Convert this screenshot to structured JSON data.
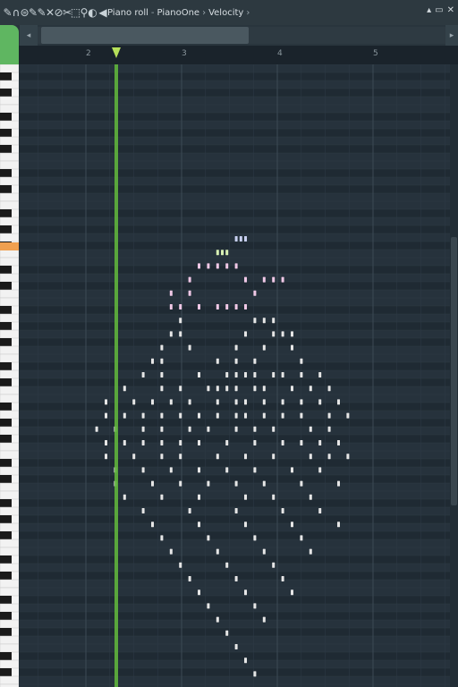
{
  "titlebar": {
    "tools": [
      {
        "name": "pencil-tool-icon",
        "glyph": "✎"
      },
      {
        "name": "magnet-icon",
        "glyph": "∩"
      },
      {
        "name": "stamp-icon",
        "glyph": "⊜"
      },
      {
        "name": "draw-tool-icon",
        "glyph": "✎"
      },
      {
        "name": "paint-tool-icon",
        "glyph": "✎"
      },
      {
        "name": "delete-tool-icon",
        "glyph": "✕"
      },
      {
        "name": "mute-tool-icon",
        "glyph": "⊘"
      },
      {
        "name": "slice-tool-icon",
        "glyph": "✂"
      },
      {
        "name": "select-tool-icon",
        "glyph": "⬚"
      },
      {
        "name": "zoom-tool-icon",
        "glyph": "⚲"
      },
      {
        "name": "playback-tool-icon",
        "glyph": "◐"
      }
    ],
    "speaker_glyph": "◀",
    "breadcrumb": [
      "Piano roll",
      "PianoOne",
      "Velocity"
    ],
    "sep1": "-",
    "sep2": "›",
    "sep3": "›",
    "win_buttons": [
      "▴",
      "▭",
      "✕"
    ]
  },
  "scrollbar": {
    "left_arrow": "◂",
    "right_arrow": "▸"
  },
  "ruler": {
    "bars": [
      "2",
      "3",
      "4",
      "5"
    ]
  },
  "piano_roll": {
    "playhead_color": "#5fb23c",
    "note_colors": [
      "#c8d0f0",
      "#d8f0b4",
      "#f0c8e6",
      "#e6e6e6"
    ],
    "notes": [
      [
        16,
        80,
        0
      ],
      [
        18,
        80,
        0
      ],
      [
        20,
        80,
        0
      ],
      [
        8,
        88,
        1
      ],
      [
        10,
        88,
        1
      ],
      [
        12,
        88,
        1
      ],
      [
        0,
        96,
        2
      ],
      [
        4,
        96,
        2
      ],
      [
        8,
        96,
        2
      ],
      [
        12,
        96,
        2
      ],
      [
        16,
        96,
        2
      ],
      [
        -4,
        104,
        2
      ],
      [
        20,
        104,
        2
      ],
      [
        28,
        104,
        2
      ],
      [
        32,
        104,
        2
      ],
      [
        36,
        104,
        2
      ],
      [
        -12,
        112,
        2
      ],
      [
        -4,
        112,
        2
      ],
      [
        24,
        112,
        2
      ],
      [
        -12,
        120,
        2
      ],
      [
        -8,
        120,
        2
      ],
      [
        0,
        120,
        2
      ],
      [
        8,
        120,
        2
      ],
      [
        12,
        120,
        2
      ],
      [
        16,
        120,
        2
      ],
      [
        20,
        120,
        2
      ],
      [
        -8,
        128,
        3
      ],
      [
        24,
        128,
        3
      ],
      [
        28,
        128,
        3
      ],
      [
        32,
        128,
        3
      ],
      [
        -12,
        136,
        3
      ],
      [
        -8,
        136,
        3
      ],
      [
        20,
        136,
        3
      ],
      [
        32,
        136,
        3
      ],
      [
        36,
        136,
        3
      ],
      [
        40,
        136,
        3
      ],
      [
        -16,
        144,
        3
      ],
      [
        -4,
        144,
        3
      ],
      [
        16,
        144,
        3
      ],
      [
        28,
        144,
        3
      ],
      [
        40,
        144,
        3
      ],
      [
        -20,
        152,
        3
      ],
      [
        -16,
        152,
        3
      ],
      [
        8,
        152,
        3
      ],
      [
        16,
        152,
        3
      ],
      [
        24,
        152,
        3
      ],
      [
        44,
        152,
        3
      ],
      [
        -24,
        160,
        3
      ],
      [
        -16,
        160,
        3
      ],
      [
        0,
        160,
        3
      ],
      [
        12,
        160,
        3
      ],
      [
        16,
        160,
        3
      ],
      [
        20,
        160,
        3
      ],
      [
        24,
        160,
        3
      ],
      [
        32,
        160,
        3
      ],
      [
        36,
        160,
        3
      ],
      [
        44,
        160,
        3
      ],
      [
        52,
        160,
        3
      ],
      [
        -32,
        168,
        3
      ],
      [
        -16,
        168,
        3
      ],
      [
        -8,
        168,
        3
      ],
      [
        4,
        168,
        3
      ],
      [
        8,
        168,
        3
      ],
      [
        12,
        168,
        3
      ],
      [
        16,
        168,
        3
      ],
      [
        24,
        168,
        3
      ],
      [
        28,
        168,
        3
      ],
      [
        40,
        168,
        3
      ],
      [
        48,
        168,
        3
      ],
      [
        56,
        168,
        3
      ],
      [
        -40,
        176,
        3
      ],
      [
        -28,
        176,
        3
      ],
      [
        -20,
        176,
        3
      ],
      [
        -12,
        176,
        3
      ],
      [
        -4,
        176,
        3
      ],
      [
        8,
        176,
        3
      ],
      [
        16,
        176,
        3
      ],
      [
        20,
        176,
        3
      ],
      [
        28,
        176,
        3
      ],
      [
        36,
        176,
        3
      ],
      [
        44,
        176,
        3
      ],
      [
        52,
        176,
        3
      ],
      [
        60,
        176,
        3
      ],
      [
        -40,
        184,
        3
      ],
      [
        -32,
        184,
        3
      ],
      [
        -24,
        184,
        3
      ],
      [
        -16,
        184,
        3
      ],
      [
        -8,
        184,
        3
      ],
      [
        0,
        184,
        3
      ],
      [
        8,
        184,
        3
      ],
      [
        16,
        184,
        3
      ],
      [
        20,
        184,
        3
      ],
      [
        28,
        184,
        3
      ],
      [
        36,
        184,
        3
      ],
      [
        44,
        184,
        3
      ],
      [
        56,
        184,
        3
      ],
      [
        64,
        184,
        3
      ],
      [
        -44,
        192,
        3
      ],
      [
        -36,
        192,
        3
      ],
      [
        -24,
        192,
        3
      ],
      [
        -16,
        192,
        3
      ],
      [
        -4,
        192,
        3
      ],
      [
        4,
        192,
        3
      ],
      [
        16,
        192,
        3
      ],
      [
        24,
        192,
        3
      ],
      [
        32,
        192,
        3
      ],
      [
        48,
        192,
        3
      ],
      [
        56,
        192,
        3
      ],
      [
        -40,
        200,
        3
      ],
      [
        -32,
        200,
        3
      ],
      [
        -24,
        200,
        3
      ],
      [
        -16,
        200,
        3
      ],
      [
        -8,
        200,
        3
      ],
      [
        0,
        200,
        3
      ],
      [
        12,
        200,
        3
      ],
      [
        24,
        200,
        3
      ],
      [
        36,
        200,
        3
      ],
      [
        44,
        200,
        3
      ],
      [
        52,
        200,
        3
      ],
      [
        60,
        200,
        3
      ],
      [
        -40,
        208,
        3
      ],
      [
        -28,
        208,
        3
      ],
      [
        -16,
        208,
        3
      ],
      [
        -8,
        208,
        3
      ],
      [
        8,
        208,
        3
      ],
      [
        20,
        208,
        3
      ],
      [
        32,
        208,
        3
      ],
      [
        48,
        208,
        3
      ],
      [
        56,
        208,
        3
      ],
      [
        64,
        208,
        3
      ],
      [
        -36,
        216,
        3
      ],
      [
        -24,
        216,
        3
      ],
      [
        -12,
        216,
        3
      ],
      [
        0,
        216,
        3
      ],
      [
        12,
        216,
        3
      ],
      [
        24,
        216,
        3
      ],
      [
        40,
        216,
        3
      ],
      [
        52,
        216,
        3
      ],
      [
        -36,
        224,
        3
      ],
      [
        -20,
        224,
        3
      ],
      [
        -8,
        224,
        3
      ],
      [
        4,
        224,
        3
      ],
      [
        16,
        224,
        3
      ],
      [
        28,
        224,
        3
      ],
      [
        44,
        224,
        3
      ],
      [
        60,
        224,
        3
      ],
      [
        -32,
        232,
        3
      ],
      [
        -16,
        232,
        3
      ],
      [
        0,
        232,
        3
      ],
      [
        20,
        232,
        3
      ],
      [
        32,
        232,
        3
      ],
      [
        48,
        232,
        3
      ],
      [
        -24,
        240,
        3
      ],
      [
        -4,
        240,
        3
      ],
      [
        16,
        240,
        3
      ],
      [
        36,
        240,
        3
      ],
      [
        52,
        240,
        3
      ],
      [
        -20,
        248,
        3
      ],
      [
        0,
        248,
        3
      ],
      [
        20,
        248,
        3
      ],
      [
        40,
        248,
        3
      ],
      [
        60,
        248,
        3
      ],
      [
        -16,
        256,
        3
      ],
      [
        4,
        256,
        3
      ],
      [
        24,
        256,
        3
      ],
      [
        44,
        256,
        3
      ],
      [
        -12,
        264,
        3
      ],
      [
        8,
        264,
        3
      ],
      [
        28,
        264,
        3
      ],
      [
        48,
        264,
        3
      ],
      [
        -8,
        272,
        3
      ],
      [
        12,
        272,
        3
      ],
      [
        32,
        272,
        3
      ],
      [
        -4,
        280,
        3
      ],
      [
        16,
        280,
        3
      ],
      [
        36,
        280,
        3
      ],
      [
        0,
        288,
        3
      ],
      [
        20,
        288,
        3
      ],
      [
        40,
        288,
        3
      ],
      [
        4,
        296,
        3
      ],
      [
        24,
        296,
        3
      ],
      [
        8,
        304,
        3
      ],
      [
        28,
        304,
        3
      ],
      [
        12,
        312,
        3
      ],
      [
        16,
        320,
        3
      ],
      [
        20,
        328,
        3
      ],
      [
        24,
        336,
        3
      ]
    ]
  }
}
